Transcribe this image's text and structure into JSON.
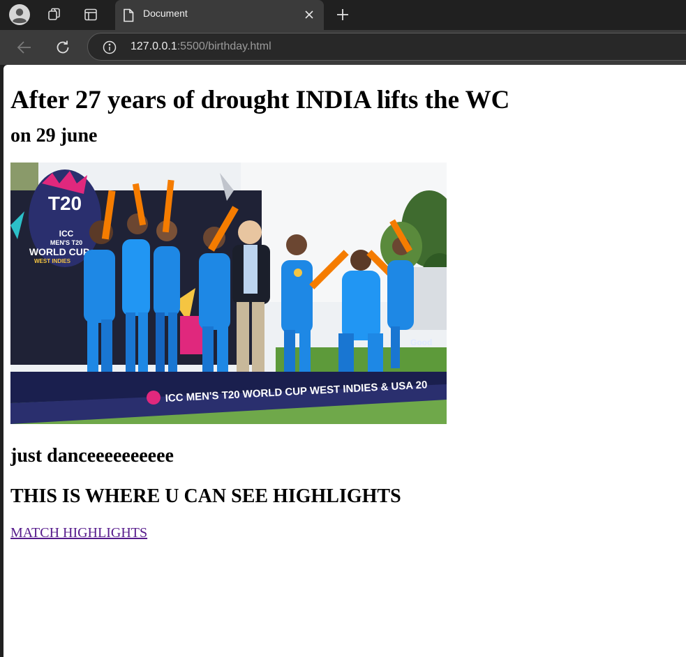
{
  "browser": {
    "tab_title": "Document",
    "url_host": "127.0.0.1",
    "url_rest": ":5500/birthday.html"
  },
  "page": {
    "heading": "After 27 years of drought INDIA lifts the WC",
    "date_line": "on 29 june",
    "image": {
      "badge_number": "T20",
      "badge_line1": "ICC",
      "badge_line2": "MEN'S T20",
      "badge_line3": "WORLD CUP",
      "badge_line4": "WEST INDIES",
      "banner_text": "ICC MEN'S T20 WORLD CUP WEST INDIES & USA 20",
      "sponsor": "Good"
    },
    "dance_line": "just danceeeeeeeeee",
    "highlights_heading": "THIS IS WHERE U CAN SEE HIGHLIGHTS",
    "highlights_link": "MATCH HIGHLIGHTS"
  },
  "colors": {
    "link_visited": "#551a8b",
    "jersey_blue": "#1e88e5",
    "jersey_orange": "#f57c00",
    "stage_navy": "#1a1f4e",
    "brand_pink": "#e0287d"
  }
}
